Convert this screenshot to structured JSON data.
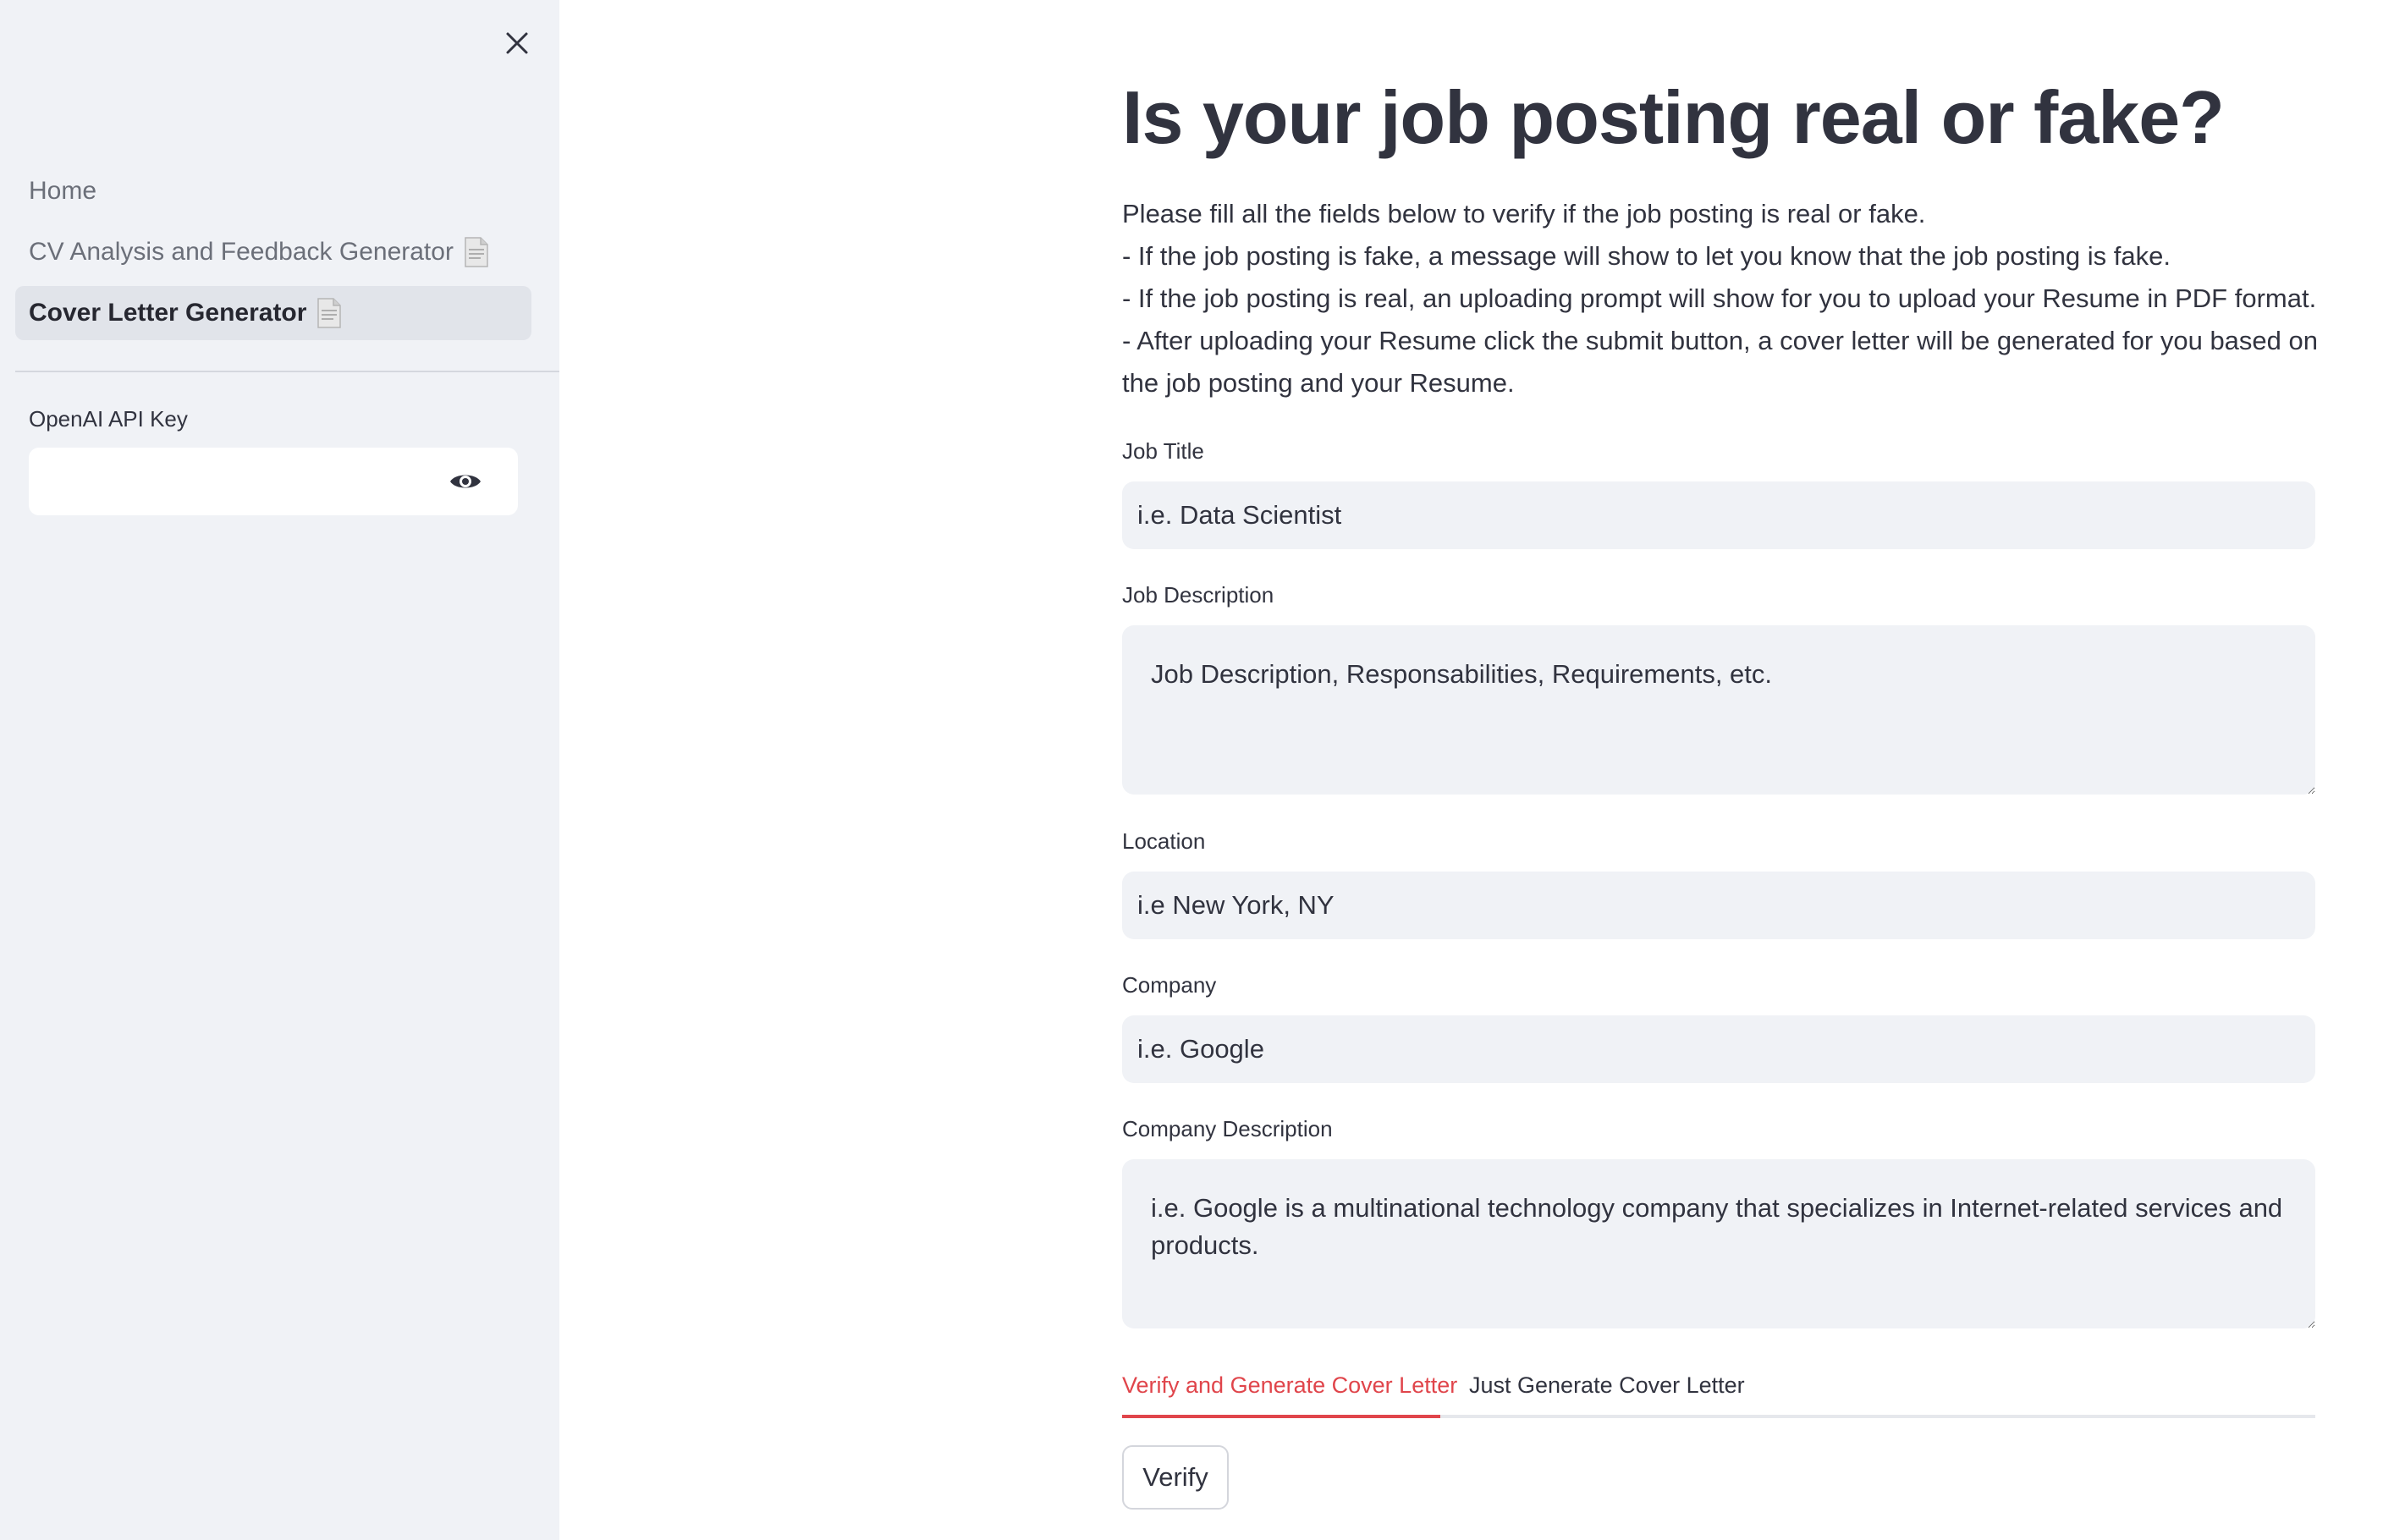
{
  "sidebar": {
    "nav": [
      {
        "label": "Home"
      },
      {
        "label": "CV Analysis and Feedback Generator"
      },
      {
        "label": "Cover Letter Generator"
      }
    ],
    "api_key": {
      "label": "OpenAI API Key",
      "value": ""
    },
    "icons": {
      "close": "close-icon",
      "eye": "eye-icon",
      "document": "document-icon"
    }
  },
  "main": {
    "title": "Is your job posting real or fake?",
    "intro": [
      "Please fill all the fields below to verify if the job posting is real or fake.",
      "- If the job posting is fake, a message will show to let you know that the job posting is fake.",
      "- If the job posting is real, an uploading prompt will show for you to upload your Resume in PDF format.",
      "- After uploading your Resume click the submit button, a cover letter will be generated for you based on",
      "the job posting and your Resume."
    ],
    "fields": {
      "job_title": {
        "label": "Job Title",
        "placeholder": "i.e. Data Scientist"
      },
      "job_description": {
        "label": "Job Description",
        "placeholder": "Job Description, Responsabilities, Requirements, etc."
      },
      "location": {
        "label": "Location",
        "placeholder": "i.e New York, NY"
      },
      "company": {
        "label": "Company",
        "placeholder": "i.e. Google"
      },
      "company_description": {
        "label": "Company Description",
        "placeholder": "i.e. Google is a multinational technology company that specializes in Internet-related services and products."
      }
    },
    "tabs": [
      {
        "label": "Verify and Generate Cover Letter",
        "active": true
      },
      {
        "label": "Just Generate Cover Letter",
        "active": false
      }
    ],
    "verify_button": "Verify"
  },
  "colors": {
    "accent": "#e0454b",
    "sidebar_bg": "#f0f2f6",
    "text": "#31333f"
  }
}
